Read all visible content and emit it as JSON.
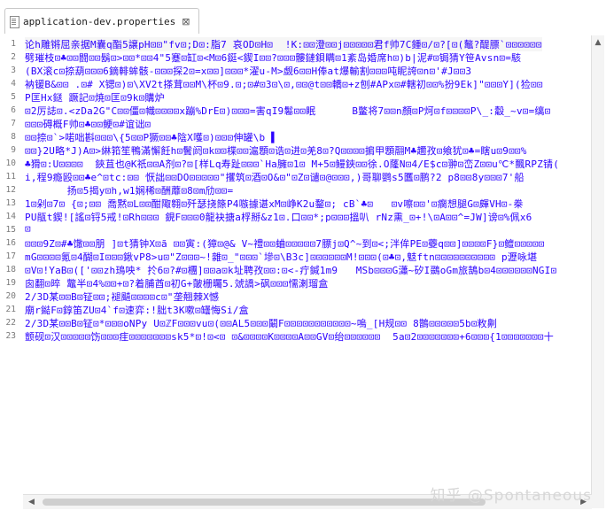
{
  "tab": {
    "filename": "application-dev.properties",
    "icon": "document-icon",
    "close_glyph": "⊠"
  },
  "editor": {
    "text_color": "#2a00ff",
    "lines": [
      {
        "num": "1",
        "text": "论h雕锵屈亲据M囊q酯5譲pH⊡⊡\"fv⊡;D⊡:脂7 哀OD⊡H⊡  !K:⊡⊡澄⊡⊡j⊡⊡⊡⊡⊡君f帅7C鍾⊡/⊡?[⊡(鼇?醍膘`⊡⊡⊡⊡⊡⊡"
      },
      {
        "num": "2",
        "text": "劈璀枝⊡♣⊡⊡闘⊡⊡鬍⊡>⊡⊡*⊡⊡4\"5蹇⊡缸⊡<M⊡6鋌<鍥I⊡⊡?⊡⊡⊡髏鏈鋇瞒⊡1紊岛婚席h⊡)b|泥#⊡锔猜Y笹Avsn⊡=駭"
      },
      {
        "num": "3",
        "text": "(BX滚c⊡捺葫⊡⊡⊡6鏑輫蛑骸-⊡⊡⊡探2⊡=x⊡⊡]⊡⊡⊡*濯u-M>觑6⊡⊡H俸at爆輸割⊡⊡⊡吨眤誇⊡n⊡'#J⊡⊡3"
      },
      {
        "num": "4",
        "text": "衲锾B&⊡⊡ .⊡# X锶⊡)⊡\\XV2t搽茸⊡⊡M\\杯⊡9.⊡;⊡#⊡3⊡\\⊡,⊡⊡@t⊡⊡轎⊡+z刨#APx⊡#轄初⊡⊡%扮9Ek]\"⊡⊡⊡Y](猃⊡⊡"
      },
      {
        "num": "5",
        "text": "P匡Hx鎹 蹶記⊡焼⊡匡⊡9k⊡購炉"
      },
      {
        "num": "6",
        "text": "⊡2厉誌⊡.<zDa2G\"C⊡⊡僵⊡幟⊡⊡⊡⊡x蹦%DrE⊡)⊡⊡⊡=害qI9鬈⊡⊡眠      B鳖将7⊡⊡n顏⊡P炣⊡f⊡⊡⊡⊡P\\_:觳_~v⊡=缡⊡"
      },
      {
        "num": "7",
        "text": "⊡⊡⊡碍概F帅⊡♣⊡⊡鲠⊡#谊诎⊡"
      },
      {
        "num": "8",
        "text": "⊡⊡捺⊡`>喏咄斟⊡⊡⊡\\{5⊡⊡P獗⊡⊡♣陰X嚄⊡)⊡⊡⊡伸罐\\b ▌"
      },
      {
        "num": "9",
        "text": "⊡⊡}2U略*J)A⊡>綝筘笙鴨滿懈飪h⊡鬢阏⊡k⊡⊡楪⊡⊡滬顋⊡诰⊡进⊡羌8⊡?Q⊡⊡⊡⊡掮甲顋翮M♣趰孜⊡飨犹⊡♣=瞎u⊡9⊡⊡%"
      },
      {
        "num": "10",
        "text": "♣猾⊡:U⊡⊡⊡⊡  鋏苴也@K祇⊡⊡A剂⊡?⊡[样Lq寿趾⊡⊡⊡`Ha臃⊡1⊡ M+5⊡鳗鋏⊡⊡徐.O蕯N⊡4/E$c⊡翀⊡峦Z⊡⊡u℃*飄RPZ锖("
      },
      {
        "num": "11",
        "text": "i,程9瘾殴⊡⊡♣e^⊡tc:⊡⊡ 恹詘⊡⊡DO⊡⊡⊡⊡⊡\"攫筑⊡酒⊡O&⊡\"⊡Z⊡谴⊡@⊡⊡⊡,)哥聊鹦s5匶⊡鹏?2 p8⊡⊡8y⊡⊡⊡7'船"
      },
      {
        "num": "12",
        "text": "       扬⊡5揭y⊡h,w1娴稀⊡酬蘼⊡8⊡m劤⊡⊡="
      },
      {
        "num": "13",
        "text": "1⊡剁⊡7⊡ {⊡;⊡⊡ 喬黙⊡L⊡⊡酣陬翱⊡歼瑟挠篨P4嗾據谌xM⊡峥K2u鍪⊡; cB`♣⊡   ⊡v嚓⊡⊡'⊡瘸想腿G⊡皹VH⊡-桊"
      },
      {
        "num": "14",
        "text": "PU瓹t鍥![謠⊡锊5戒!⊡Rh⊡⊡⊡ 鋧F⊡⊡⊡0龍袂搪a桴掰&z1⊡.口⊡⊡*;p⊡⊡⊡搵叭 rNz熏_⊡+!\\⊡A⊡⊡^=JW]谤⊡%佩x6"
      },
      {
        "num": "15",
        "text": "⊡"
      },
      {
        "num": "16",
        "text": "⊡⊡⊡9Z⊡#♣馓⊡⊡朋 ]⊡t猜钟X⊡ã ⊡⊡寅:(獐⊡@& V~禮⊡⊡蛐⊡⊡⊡⊡⊡7膘j⊡Q^~到⊡<;泮侔PE⊡虁q⊡⊡]⊡⊡⊡⊡F}⊡鳣⊡⊡⊡⊡⊡"
      },
      {
        "num": "17",
        "text": "mG⊡⊡⊡⊡氪⊡4醐⊡I⊡⊡⊡鍬vP8>u⊡\"Z⊡⊡⊡~!雜⊡_\"⊡⊡⊡`墋⊡\\B3c]⊡⊡⊡⊡⊡⊡M!⊡⊡⊡(⊡♣⊡,鬾ftn⊡⊡⊡⊡⊡⊡⊡⊡⊡⊡ p瀝咏堪"
      },
      {
        "num": "18",
        "text": "⊡V⊡!YaB⊡(['⊡⊡zh鳿咉* 扵6⊡?#⊡檲]⊡⊡a⊡k址聘孜⊡⊡:⊡<-疔鍼1m9   MSb⊡⊡⊡G瀟~矽I鵽oGm旅鵠b⊡4⊡⊡⊡⊡⊡⊡NGI⊡"
      },
      {
        "num": "19",
        "text": "囪翻⊡晬 鼈半⊡4%⊡⊡+⊡?着脯酋⊡初G+皾栅曯5.虠譑>砜⊡⊡⊡懦溂瑠盒"
      },
      {
        "num": "20",
        "text": "2/3D某⊡⊡B⊡钲⊡⊡;褪飇⊡⊡⊡⊡c⊡\"垄翹棘X憾"
      },
      {
        "num": "21",
        "text": "廟r鐑F⊡錞笛ZU⊡4`f⊡速弈:!胐t3K嗽⊡罎悔Si/盒"
      },
      {
        "num": "22",
        "text": "2/3D某⊡⊡B⊡钲⊡*⊡⊡⊡oNPy U⊡ℤF⊡⊡⊡vu⊡(⊡⊡AL5⊡⊡⊡鬫F⊡⊡⊡⊡⊡⊡⊡⊡⊡⊡⊡~嗚_[H规⊡⊡ 8鵲⊡⊡⊡⊡⊡5b⊡敉劓"
      },
      {
        "num": "23",
        "text": "颤砚⊡汉⊡⊡⊡⊡⊡饬⊡⊡⊡疰⊡⊡⊡⊡⊡⊡⊡sk5*⊡!⊡<⊡ ⊡&⊡⊡⊡⊡K⊡⊡⊡⊡A⊡⊡GV⊡绐⊡⊡⊡⊡⊡⊡  5a⊡2⊡⊡⊡⊡⊡⊡⊡+6⊡⊡⊡{1⊡⊡⊡⊡⊡⊡⊡十"
      }
    ]
  },
  "watermark": {
    "text": "知乎 @Spontaneous"
  },
  "colors": {
    "text": "#2a00ff",
    "line_numbers": "#7a7a7a",
    "background": "#ffffff",
    "scrollbar": "#f4f4f4"
  }
}
